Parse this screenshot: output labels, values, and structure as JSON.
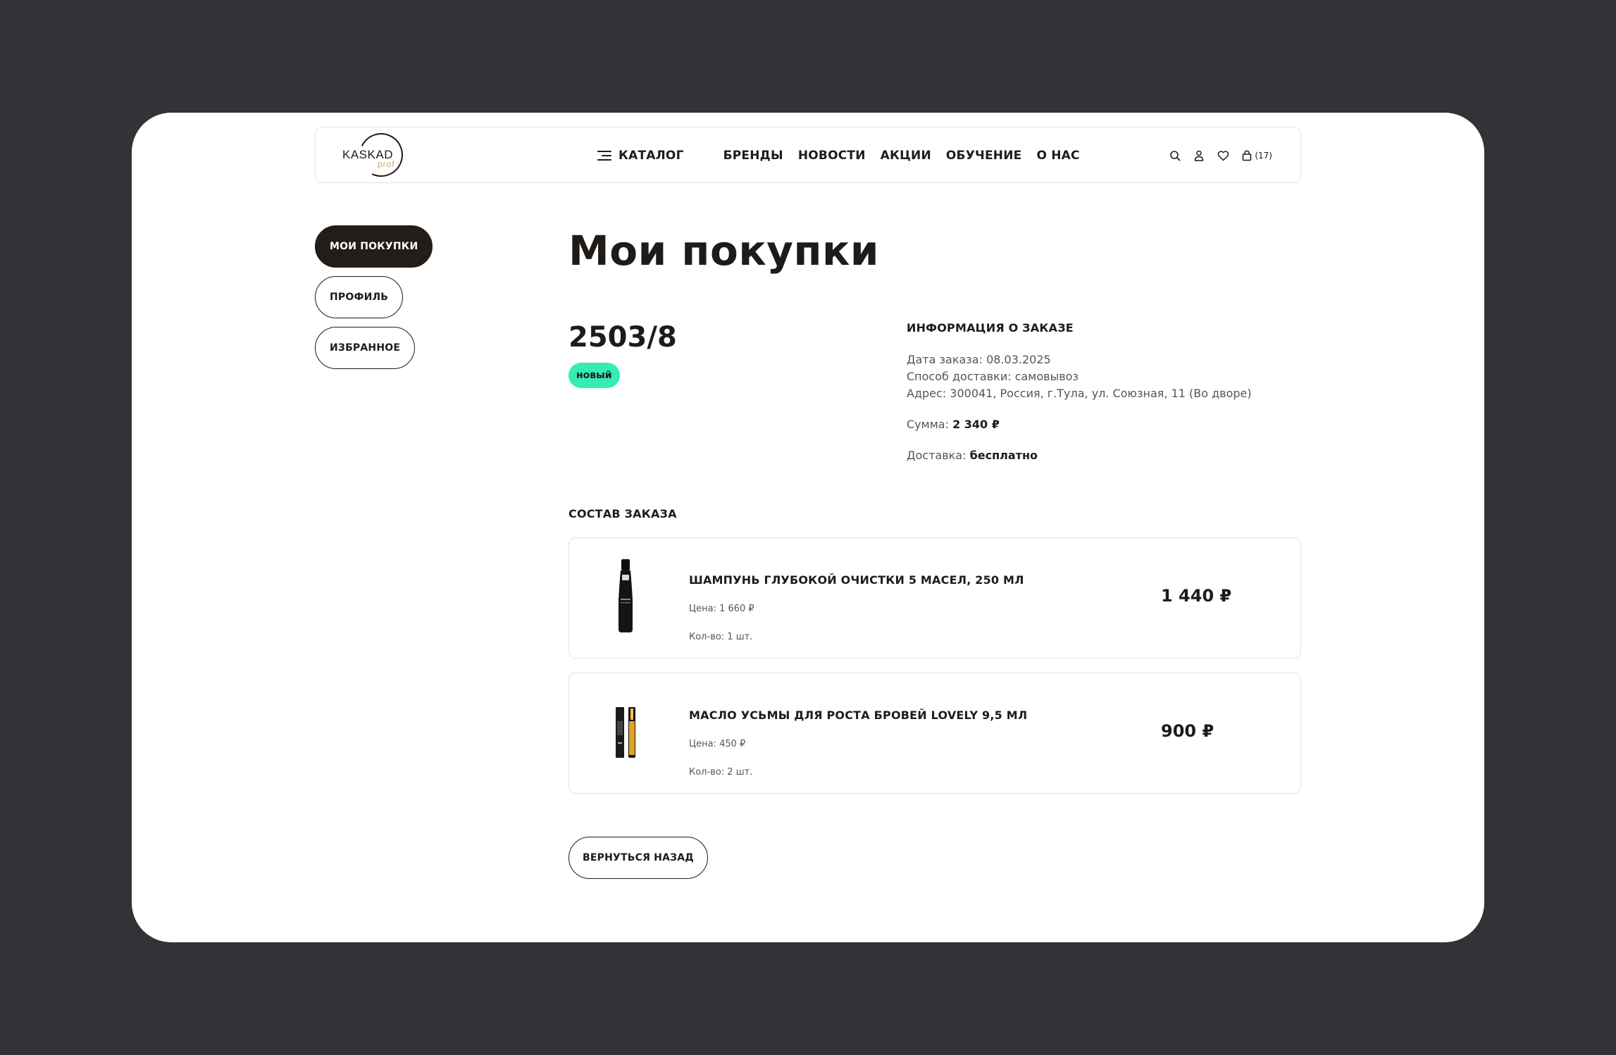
{
  "header": {
    "logo_text": "KASKAD",
    "logo_sub": "prof",
    "catalog_label": "КАТАЛОГ",
    "nav": [
      "БРЕНДЫ",
      "НОВОСТИ",
      "АКЦИИ",
      "ОБУЧЕНИЕ",
      "О НАС"
    ],
    "cart_count": "(17)",
    "icons": [
      "search-icon",
      "user-icon",
      "heart-icon",
      "bag-icon"
    ]
  },
  "sidebar": {
    "items": [
      {
        "label": "МОИ ПОКУПКИ",
        "active": true
      },
      {
        "label": "ПРОФИЛЬ",
        "active": false
      },
      {
        "label": "ИЗБРАННОЕ",
        "active": false
      }
    ]
  },
  "main": {
    "title": "Мои покупки",
    "order_number": "2503/8",
    "status": "новый",
    "status_color": "#35ecb3",
    "info": {
      "title": "ИНФОРМАЦИЯ О ЗАКАЗЕ",
      "date": "Дата заказа: 08.03.2025",
      "delivery_method": "Способ доставки: самовывоз",
      "address": "Адрес: 300041, Россия, г.Тула, ул. Союзная, 11 (Во дворе)",
      "sum_label": "Сумма:",
      "sum_value": "2 340 ₽",
      "delivery_label": "Доставка:",
      "delivery_value": "бесплатно"
    },
    "composition_title": "СОСТАВ ЗАКАЗА",
    "items": [
      {
        "name": "ШАМПУНЬ ГЛУБОКОЙ ОЧИСТКИ 5 МАСЕЛ, 250 МЛ",
        "price": "Цена: 1 660 ₽",
        "qty": "Кол-во: 1 шт.",
        "total": "1 440 ₽"
      },
      {
        "name": "МАСЛО УСЬМЫ ДЛЯ РОСТА БРОВЕЙ LOVELY 9,5 МЛ",
        "price": "Цена: 450 ₽",
        "qty": "Кол-во: 2 шт.",
        "total": "900 ₽"
      }
    ],
    "back_label": "ВЕРНУТЬСЯ НАЗАД"
  }
}
